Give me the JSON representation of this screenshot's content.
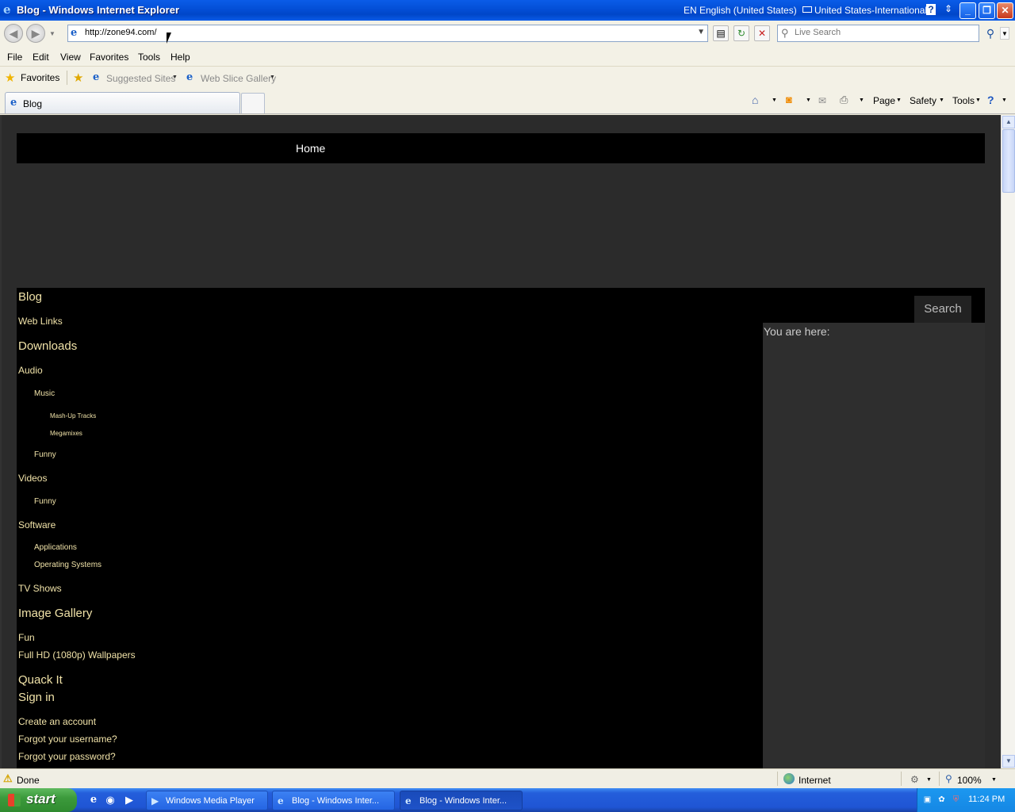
{
  "window": {
    "title": "Blog - Windows Internet Explorer",
    "language": "EN English (United States)",
    "keyboard": "United States-International"
  },
  "address": {
    "url": "http://zone94.com/",
    "search_placeholder": "Live Search"
  },
  "menu": [
    "File",
    "Edit",
    "View",
    "Favorites",
    "Tools",
    "Help"
  ],
  "favorites_bar": {
    "favorites_label": "Favorites",
    "suggested_sites": "Suggested Sites",
    "web_slice_gallery": "Web Slice Gallery"
  },
  "tab": {
    "label": "Blog"
  },
  "command_bar": {
    "page": "Page",
    "safety": "Safety",
    "tools": "Tools"
  },
  "page": {
    "top_nav": "Home",
    "search_button": "Search",
    "breadcrumb_label": "You are here:",
    "menu_items": [
      "Blog",
      "Web Links",
      "Downloads",
      "Audio",
      "Music",
      "Mash-Up Tracks",
      "Megamixes",
      "Funny",
      "Videos",
      "Funny",
      "Software",
      "Applications",
      "Operating Systems",
      "TV Shows",
      "Image Gallery",
      "Fun",
      "Full HD (1080p) Wallpapers",
      "Quack It",
      "Sign in",
      "Create an account",
      "Forgot your username?",
      "Forgot your password?"
    ]
  },
  "status_bar": {
    "status": "Done",
    "zone": "Internet",
    "zoom": "100%"
  },
  "taskbar": {
    "start": "start",
    "items": [
      "Windows Media Player",
      "Blog - Windows Inter...",
      "Blog - Windows Inter..."
    ],
    "clock": "11:24 PM"
  }
}
